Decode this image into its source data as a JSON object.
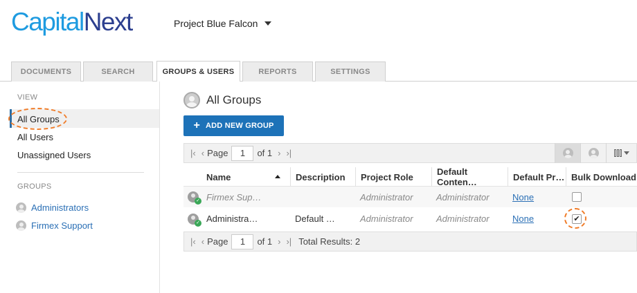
{
  "header": {
    "logo_part1": "Capital",
    "logo_part2": "Next",
    "project_name": "Project Blue Falcon"
  },
  "tabs": [
    {
      "label": "DOCUMENTS"
    },
    {
      "label": "SEARCH"
    },
    {
      "label": "GROUPS & USERS",
      "active": true
    },
    {
      "label": "REPORTS"
    },
    {
      "label": "SETTINGS"
    }
  ],
  "sidebar": {
    "view_heading": "VIEW",
    "view_items": [
      {
        "label": "All Groups",
        "selected": true
      },
      {
        "label": "All Users"
      },
      {
        "label": "Unassigned Users"
      }
    ],
    "groups_heading": "GROUPS",
    "group_items": [
      {
        "label": "Administrators"
      },
      {
        "label": "Firmex Support"
      }
    ]
  },
  "main": {
    "title": "All Groups",
    "add_button_label": "ADD NEW GROUP",
    "pager_top": {
      "page_label": "Page",
      "page_value": "1",
      "of_label": "of 1"
    },
    "pager_bottom": {
      "page_label": "Page",
      "page_value": "1",
      "of_label": "of 1",
      "total": "Total Results: 2"
    },
    "columns": [
      "Name",
      "Description",
      "Project Role",
      "Default Conten…",
      "Default Pr…",
      "Bulk Download"
    ],
    "rows": [
      {
        "name": "Firmex Sup…",
        "description": "",
        "project_role": "Administrator",
        "default_content": "Administrator",
        "default_pr": "None",
        "bulk_download": false
      },
      {
        "name": "Administra…",
        "description": "Default …",
        "project_role": "Administrator",
        "default_content": "Administrator",
        "default_pr": "None",
        "bulk_download": true
      }
    ]
  },
  "colors": {
    "accent": "#1d72b8",
    "link": "#2a6fb5",
    "logo_light": "#1e9be0",
    "logo_dark": "#2c3f8f",
    "highlight": "#f07d2a"
  }
}
